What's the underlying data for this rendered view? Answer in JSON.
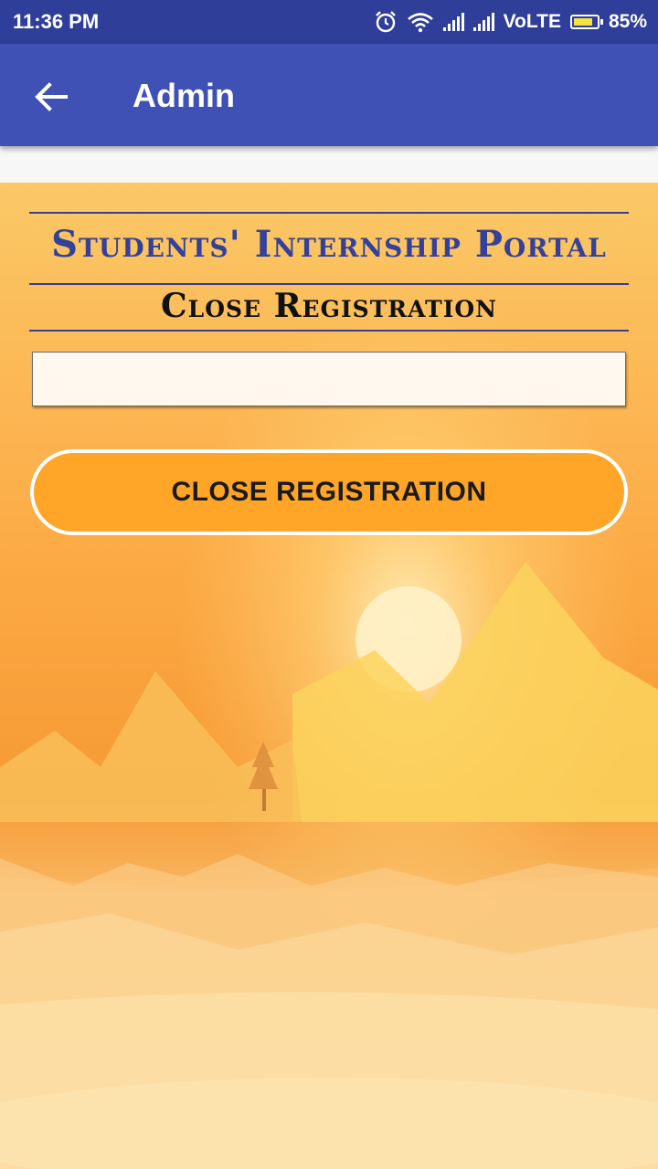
{
  "status_bar": {
    "time": "11:36 PM",
    "network": "VoLTE",
    "battery": "85%",
    "battery_level": 0.85,
    "icons": [
      "alarm-icon",
      "wifi-icon",
      "signal-icon",
      "signal-icon",
      "battery-icon"
    ]
  },
  "app_bar": {
    "title": "Admin",
    "back_icon": "arrow-back-icon"
  },
  "main": {
    "portal_title": "Students' Internship Portal",
    "sub_title": "Close Registration",
    "input_value": "",
    "button_label": "CLOSE REGISTRATION"
  },
  "colors": {
    "status_bar": "#2f3e98",
    "app_bar": "#3f51b5",
    "portal_title": "#34419a",
    "button": "#ffa528",
    "input_bg": "#fff8ee"
  }
}
